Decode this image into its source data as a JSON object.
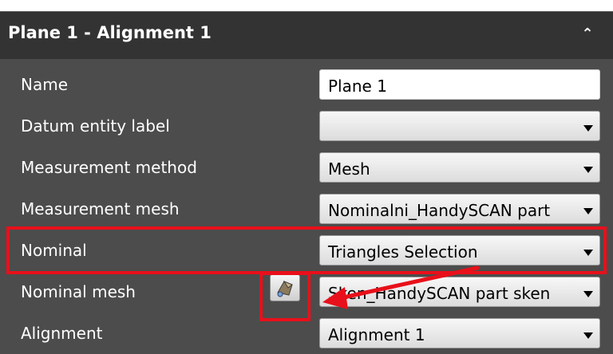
{
  "panel": {
    "title": "Plane 1 - Alignment 1",
    "collapse_icon": "chevron-up-icon"
  },
  "rows": [
    {
      "label": "Name",
      "value": "Plane 1",
      "kind": "text"
    },
    {
      "label": "Datum entity label",
      "value": "",
      "kind": "dropdown"
    },
    {
      "label": "Measurement method",
      "value": "Mesh",
      "kind": "dropdown"
    },
    {
      "label": "Measurement mesh",
      "value": "Nominalni_HandySCAN part",
      "kind": "dropdown"
    },
    {
      "label": "Nominal",
      "value": "Triangles Selection",
      "kind": "dropdown"
    },
    {
      "label": "Nominal mesh",
      "value": "Sken_HandySCAN part sken",
      "kind": "dropdown",
      "button_icon": "pick-mesh-icon"
    },
    {
      "label": "Alignment",
      "value": "Alignment 1",
      "kind": "dropdown"
    }
  ],
  "annotations": {
    "color": "#e8101a",
    "arrow_icon": "red-arrow-icon"
  }
}
